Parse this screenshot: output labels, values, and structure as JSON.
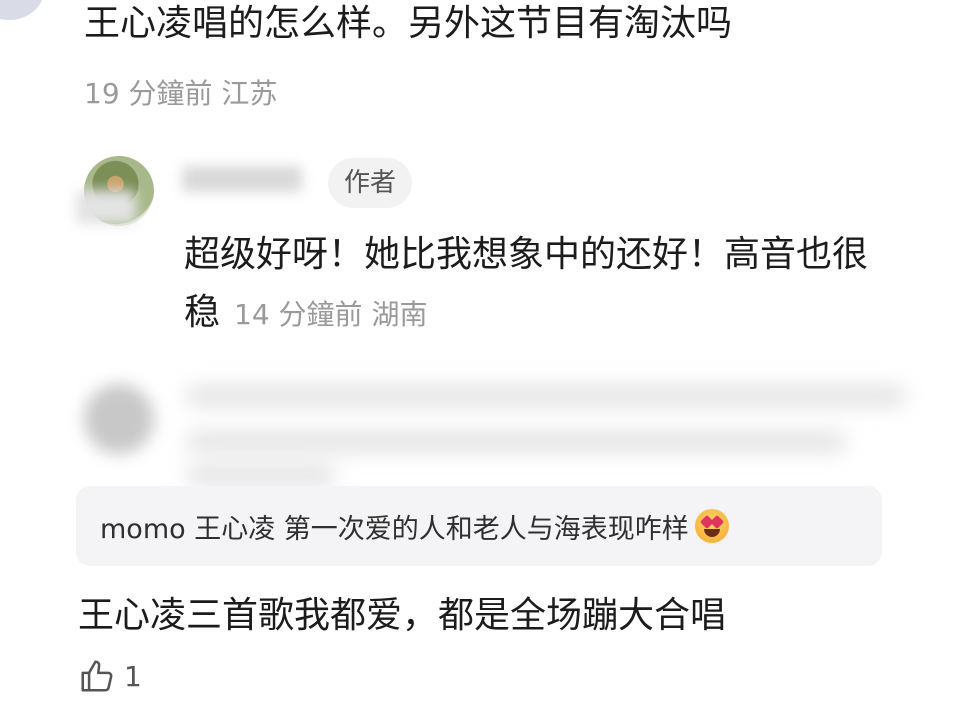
{
  "comment1": {
    "text": "王心凌唱的怎么样。另外这节目有淘汰吗",
    "meta": "19 分鐘前 江苏"
  },
  "reply": {
    "badge": "作者",
    "text": "超级好呀！她比我想象中的还好！高音也很稳",
    "meta": "14 分鐘前 湖南"
  },
  "quote": {
    "text": "momo 王心凌 第一次爱的人和老人与海表现咋样",
    "emoji": "heart-eyes-emoji"
  },
  "main_comment": {
    "text": "王心凌三首歌我都爱，都是全场蹦大合唱"
  },
  "like": {
    "icon": "thumbs-up-icon",
    "count": "1"
  },
  "colors": {
    "text": "#1c1c1c",
    "meta": "#9a9a9a",
    "quote_bg": "#f4f4f6",
    "badge_bg": "#f2f2f2"
  }
}
